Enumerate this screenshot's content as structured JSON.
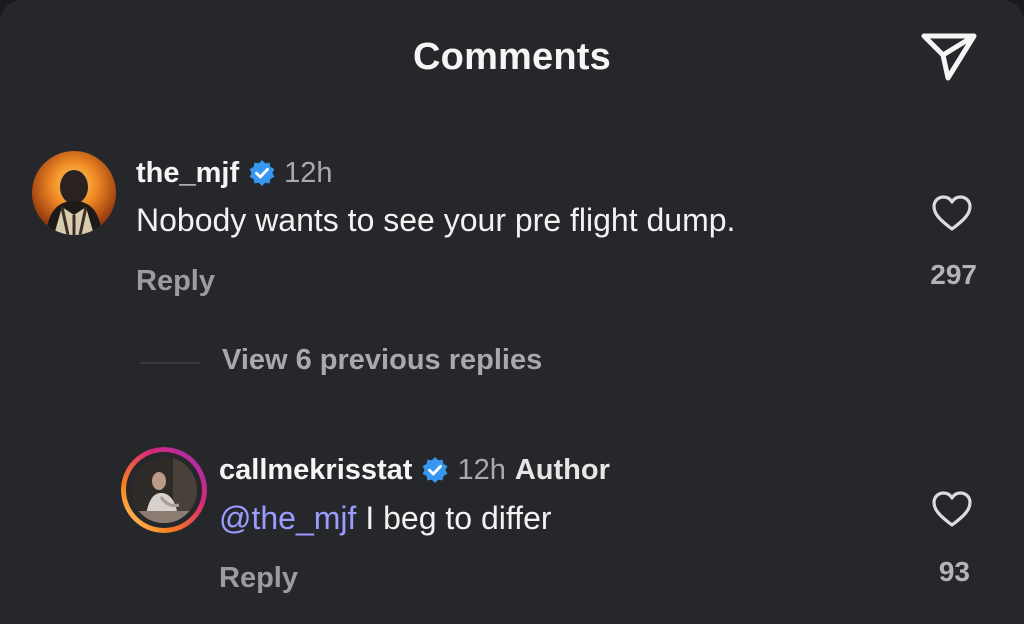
{
  "header": {
    "title": "Comments",
    "share_icon": "send-icon"
  },
  "comments": [
    {
      "username": "the_mjf",
      "verified": true,
      "time": "12h",
      "text": "Nobody wants to see your pre flight dump.",
      "reply_label": "Reply",
      "likes": "297",
      "avatar_icon": "avatar"
    }
  ],
  "view_replies_label": "View 6 previous replies",
  "replies": [
    {
      "username": "callmekrisstat",
      "verified": true,
      "time": "12h",
      "badge": "Author",
      "mention": "@the_mjf",
      "text": " I beg to differ",
      "reply_label": "Reply",
      "likes": "93",
      "avatar_icon": "avatar-story-ring"
    }
  ],
  "colors": {
    "background": "#26272b",
    "verified": "#3797f0",
    "mention": "#9a9cff",
    "story_ring": [
      "#feda75",
      "#fa7e1e",
      "#d62976",
      "#962fbf"
    ]
  }
}
